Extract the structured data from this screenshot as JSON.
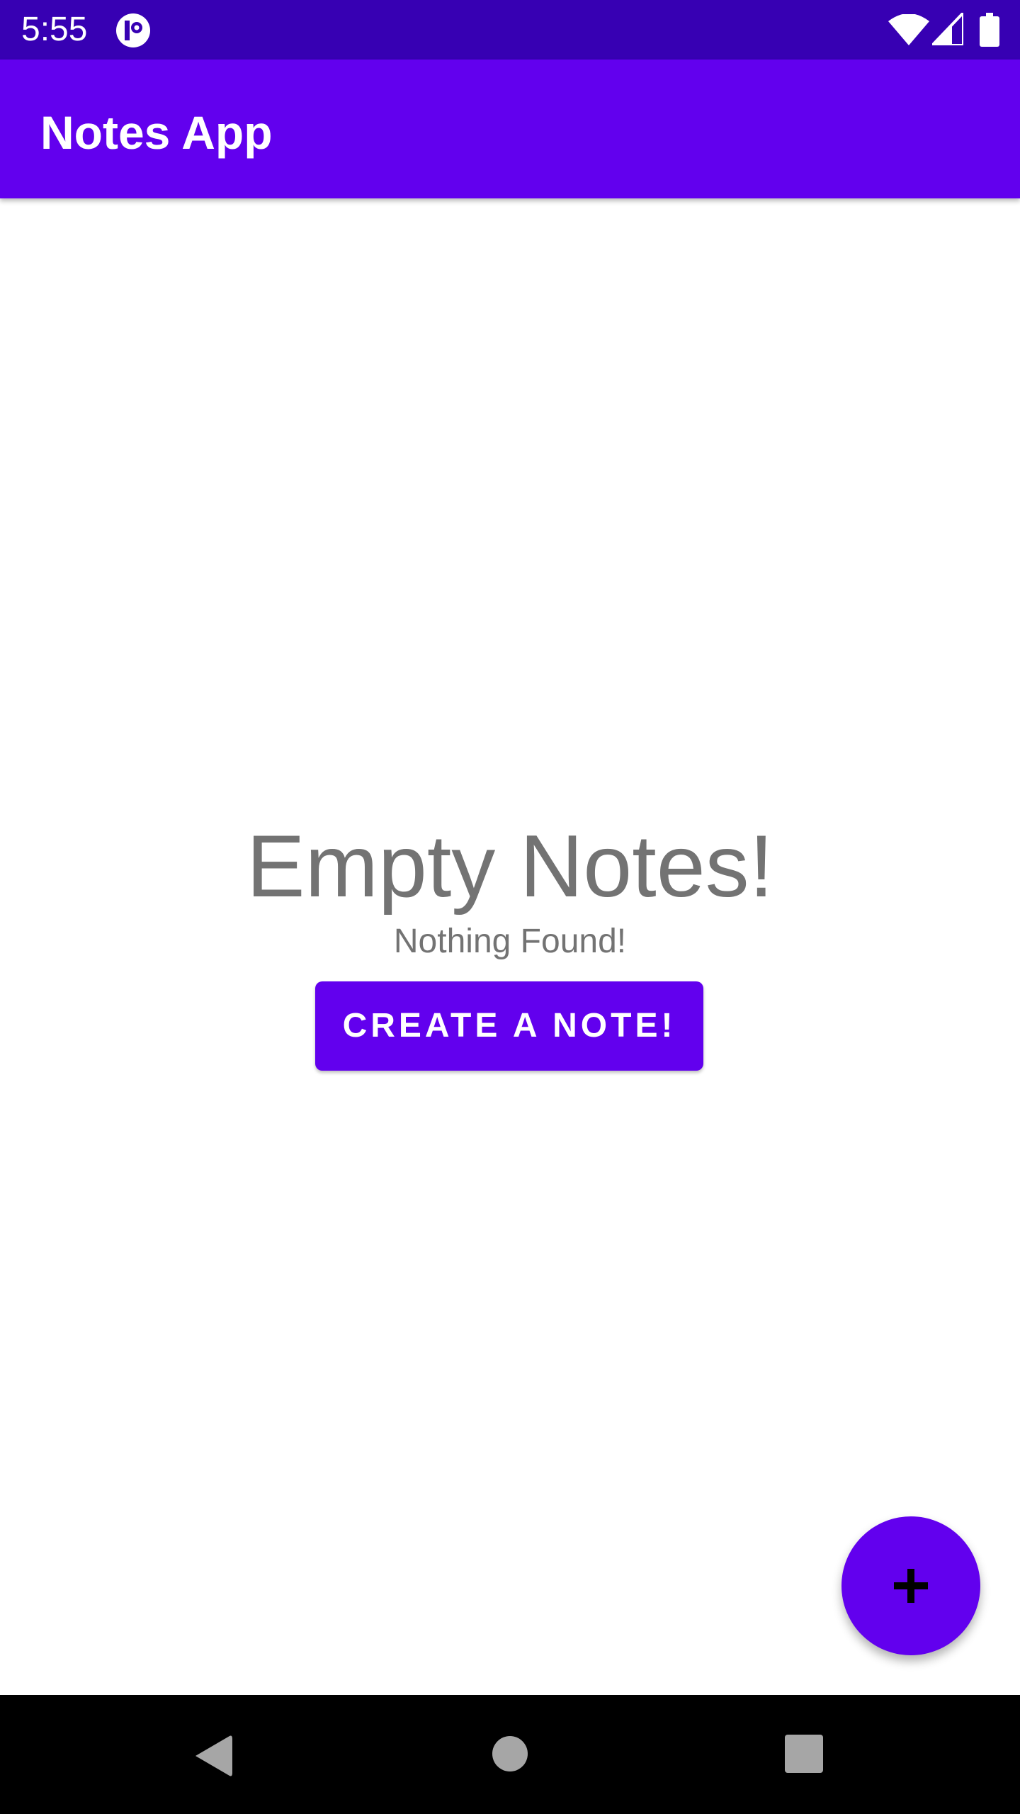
{
  "status_bar": {
    "time": "5:55",
    "icons": [
      "app-notification-icon",
      "wifi-icon",
      "cell-signal-icon",
      "battery-icon"
    ]
  },
  "app_bar": {
    "title": "Notes App"
  },
  "empty_state": {
    "title": "Empty Notes!",
    "subtitle": "Nothing Found!",
    "button_label": "CREATE A NOTE!"
  },
  "fab": {
    "icon": "plus-icon"
  },
  "nav_bar": {
    "icons": [
      "back-icon",
      "home-icon",
      "recents-icon"
    ]
  },
  "colors": {
    "status_bar": "#3700b3",
    "primary": "#6200ee",
    "text_muted": "#737373",
    "background": "#ffffff",
    "nav_bar": "#000000"
  }
}
